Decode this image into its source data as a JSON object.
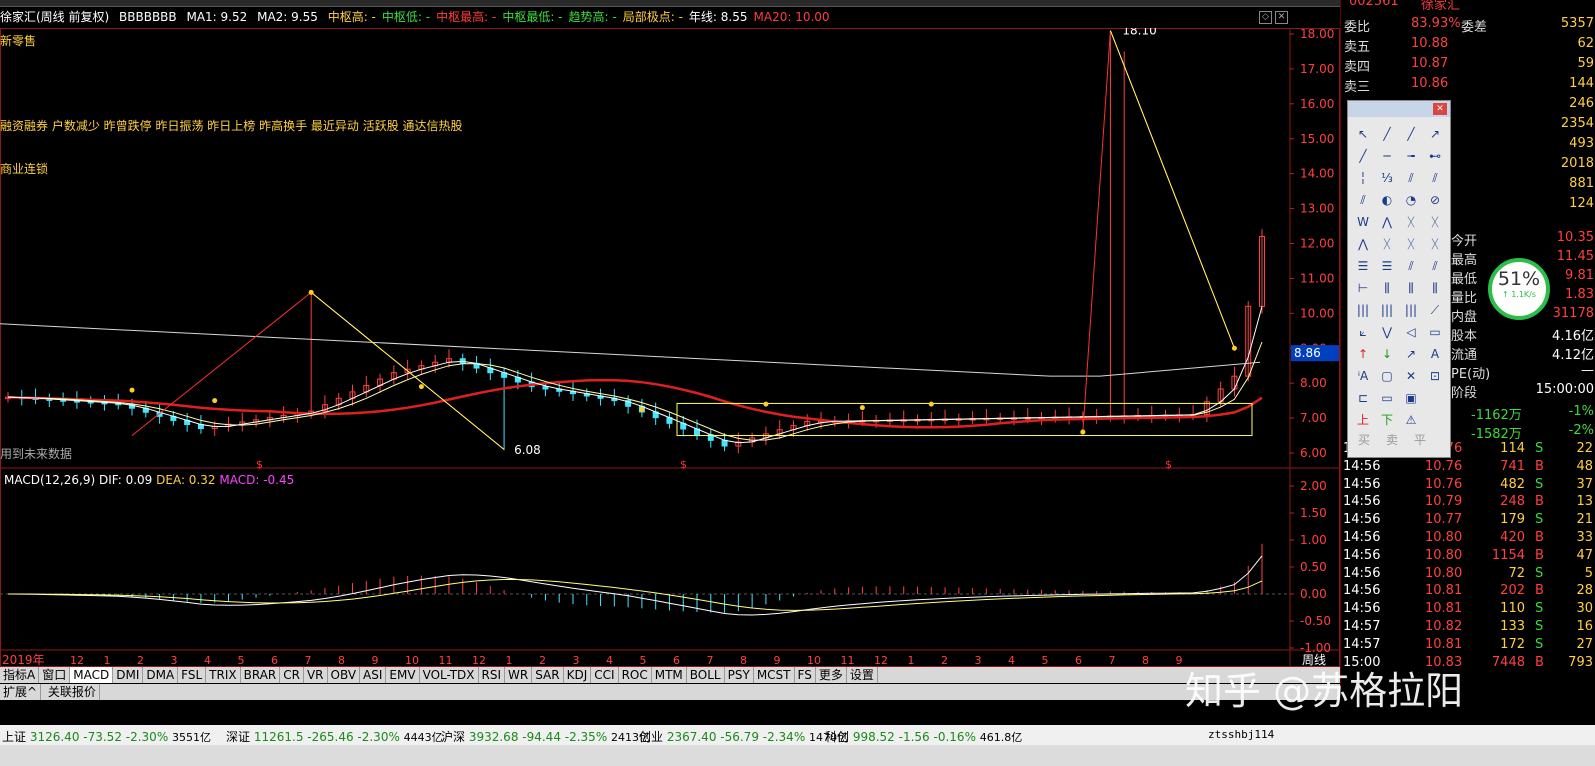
{
  "infobar": {
    "stock": "徐家汇(周线 前复权)",
    "code_label": "BBBBBBB",
    "ma1": "MA1: 9.52",
    "ma2": "MA2: 9.55",
    "items": [
      {
        "text": "中枢高: -",
        "color": "#ffd040"
      },
      {
        "text": "中枢低: -",
        "color": "#3cdc3c"
      },
      {
        "text": "中枢最高: -",
        "color": "#ff3c3c"
      },
      {
        "text": "中枢最低: -",
        "color": "#3cdc3c"
      },
      {
        "text": "趋势高: -",
        "color": "#3cdc3c"
      },
      {
        "text": "局部极点: -",
        "color": "#ffd040"
      },
      {
        "text": "年线: 8.55",
        "color": "#fff"
      },
      {
        "text": "MA20: 10.00",
        "color": "#ff3c3c"
      }
    ]
  },
  "annotations": {
    "line1": "新零售",
    "line2": "融资融券 户数减少 昨曾跌停 昨日振荡 昨日上榜 昨高换手 最近异动 活跃股 通达信热股",
    "line3": "商业连锁",
    "future": "用到未来数据",
    "high_label": "18.10",
    "low_label": "6.08",
    "cursor_price": "8.86"
  },
  "price_axis": [
    "18.00",
    "17.00",
    "16.00",
    "15.00",
    "14.00",
    "13.00",
    "12.00",
    "11.00",
    "10.00",
    "9.00",
    "8.00",
    "7.00",
    "6.00"
  ],
  "macd": {
    "title": "MACD(12,26,9)",
    "dif": "DIF: 0.09",
    "dea": "DEA: 0.32",
    "macd": "MACD: -0.45",
    "axis": [
      "2.00",
      "1.50",
      "1.00",
      "0.50",
      "0.00",
      "-0.50",
      "-1.00"
    ]
  },
  "time_axis": {
    "year": "2019年",
    "months": [
      "12",
      "1",
      "2",
      "3",
      "4",
      "5",
      "6",
      "7",
      "8",
      "9",
      "10",
      "11",
      "12",
      "1",
      "2",
      "3",
      "4",
      "5",
      "6",
      "7",
      "8",
      "9",
      "10",
      "11",
      "12",
      "1",
      "2",
      "3",
      "4",
      "5",
      "6",
      "7",
      "8",
      "9"
    ],
    "period": "周线"
  },
  "tabs": [
    "指标A",
    "窗口",
    "MACD",
    "DMI",
    "DMA",
    "FSL",
    "TRIX",
    "BRAR",
    "CR",
    "VR",
    "OBV",
    "ASI",
    "EMV",
    "VOL-TDX",
    "RSI",
    "WR",
    "SAR",
    "KDJ",
    "CCI",
    "ROC",
    "MTM",
    "BOLL",
    "PSY",
    "MCST",
    "FS",
    "更多",
    "设置"
  ],
  "expand_bar": [
    "扩展^",
    "关联报价"
  ],
  "quote": {
    "code": "002561",
    "name": "徐家汇",
    "rows": [
      {
        "l": "委比",
        "v": "83.93%",
        "r": "委差",
        "n": "5357"
      },
      {
        "l": "卖五",
        "v": "10.88",
        "n": "62"
      },
      {
        "l": "卖四",
        "v": "10.87",
        "n": "59"
      },
      {
        "l": "卖三",
        "v": "10.86",
        "n": "144"
      },
      {
        "l": "",
        "v": "",
        "n": "246"
      },
      {
        "l": "",
        "v": "",
        "n": "2354"
      },
      {
        "l": "",
        "v": "",
        "n": "493"
      },
      {
        "l": "",
        "v": "",
        "n": "2018"
      },
      {
        "l": "",
        "v": "",
        "n": "881"
      },
      {
        "l": "",
        "v": "",
        "n": "124"
      }
    ],
    "stats": [
      {
        "l": "今开",
        "v": "10.35"
      },
      {
        "l": "最高",
        "v": "11.45"
      },
      {
        "l": "最低",
        "v": "9.81"
      },
      {
        "l": "量比",
        "v": "1.83"
      },
      {
        "l": "内盘",
        "v": "31178"
      },
      {
        "l": "股本",
        "v": "4.16亿"
      },
      {
        "l": "流通",
        "v": "4.12亿"
      },
      {
        "l": "PE(动)",
        "v": "—"
      },
      {
        "l": "阶段",
        "v": "15:00:00"
      }
    ],
    "flows": [
      {
        "v": "-1162万",
        "p": "-1%"
      },
      {
        "v": "-1582万",
        "p": "-2%"
      }
    ]
  },
  "trades": [
    {
      "t": "14:56",
      "p": "10.76",
      "v": "114",
      "s": "S",
      "n": "22"
    },
    {
      "t": "14:56",
      "p": "10.76",
      "v": "741",
      "s": "B",
      "n": "48"
    },
    {
      "t": "14:56",
      "p": "10.76",
      "v": "482",
      "s": "S",
      "n": "37"
    },
    {
      "t": "14:56",
      "p": "10.79",
      "v": "248",
      "s": "B",
      "n": "13"
    },
    {
      "t": "14:56",
      "p": "10.77",
      "v": "179",
      "s": "S",
      "n": "21"
    },
    {
      "t": "14:56",
      "p": "10.80",
      "v": "420",
      "s": "B",
      "n": "33"
    },
    {
      "t": "14:56",
      "p": "10.80",
      "v": "1154",
      "s": "B",
      "n": "47"
    },
    {
      "t": "14:56",
      "p": "10.80",
      "v": "72",
      "s": "S",
      "n": "5"
    },
    {
      "t": "14:56",
      "p": "10.81",
      "v": "202",
      "s": "B",
      "n": "28"
    },
    {
      "t": "14:56",
      "p": "10.81",
      "v": "110",
      "s": "S",
      "n": "30"
    },
    {
      "t": "14:57",
      "p": "10.82",
      "v": "133",
      "s": "S",
      "n": "16"
    },
    {
      "t": "14:57",
      "p": "10.81",
      "v": "172",
      "s": "S",
      "n": "27"
    },
    {
      "t": "15:00",
      "p": "10.83",
      "v": "7448",
      "s": "B",
      "n": "793"
    }
  ],
  "volume_pct": "51%",
  "volume_speed": "↑ 1.1K/s",
  "status": [
    {
      "name": "上证",
      "v": "3126.40",
      "c": "-73.52",
      "p": "-2.30%",
      "a": "3551亿"
    },
    {
      "name": "深证",
      "v": "11261.5",
      "c": "-265.46",
      "p": "-2.30%",
      "a": "4443亿"
    },
    {
      "name": "沪深",
      "v": "3932.68",
      "c": "-94.44",
      "p": "-2.35%",
      "a": "2413亿"
    },
    {
      "name": "创业",
      "v": "2367.40",
      "c": "-56.79",
      "p": "-2.34%",
      "a": "1470亿"
    },
    {
      "name": "科创",
      "v": "998.52",
      "c": "-1.56",
      "p": "-0.16%",
      "a": "461.8亿"
    }
  ],
  "status_user": "ztsshbj114",
  "drawtools": {
    "buy": "买",
    "sell": "卖",
    "flat": "平"
  },
  "watermark": "知乎 @苏格拉阳"
}
